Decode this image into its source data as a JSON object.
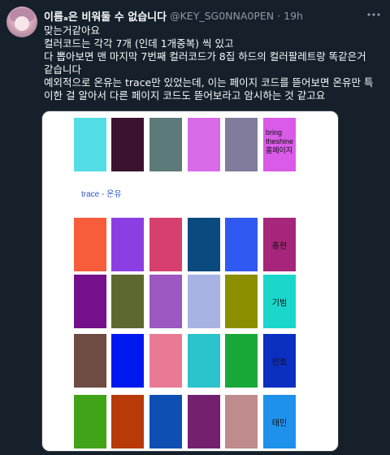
{
  "tweet": {
    "display_name": "이름ₐ은 비워둘 수 없습니다",
    "handle": "@KEY_SG0NNA0PEN",
    "separator": "·",
    "time": "19h",
    "more_icon": "more-horizontal-icon",
    "lines": [
      "맞는거같아요",
      "컬러코드는 각각 7개 (인데 1개중복) 씩 있고",
      "다 뽑아보면 맨 마지막 7번째 컬러코드가 8집 하드의 컬러팔레트랑 똑같은거",
      "같습니다",
      "예외적으로 온유는 trace만 있었는데, 이는 페이지 코드를 뜯어보면 온유만 특",
      "이한 걸 알아서 다른 페이지 코드도 뜯어보라고 암시하는 것 같고요"
    ]
  },
  "image": {
    "top_row_colors": [
      "#52dde4",
      "#3b1330",
      "#5c7a79",
      "#d86be8",
      "#817c9c"
    ],
    "top_row_note_colors": [
      "#d95be8"
    ],
    "bring_label": "bring\ntheshine\n홈페이지",
    "trace_label": "trace - 온유",
    "rows": [
      {
        "label": "종현",
        "colors": [
          "#f75d3b",
          "#8b3fe2",
          "#d63f6e",
          "#0b4a7e",
          "#3059f2",
          "#a5267a"
        ]
      },
      {
        "label": "기범",
        "colors": [
          "#750f8b",
          "#5b6930",
          "#9c57c1",
          "#a8b3e3",
          "#8a8f00",
          "#1ad6cb"
        ]
      },
      {
        "label": "민호",
        "colors": [
          "#6e4c44",
          "#0018f0",
          "#e97a96",
          "#2ac2cb",
          "#18a83a",
          "#0b2fc0"
        ]
      },
      {
        "label": "태민",
        "colors": [
          "#41a418",
          "#b73a08",
          "#0d4fb3",
          "#73206e",
          "#c08b8c",
          "#1e91eb"
        ]
      }
    ]
  }
}
